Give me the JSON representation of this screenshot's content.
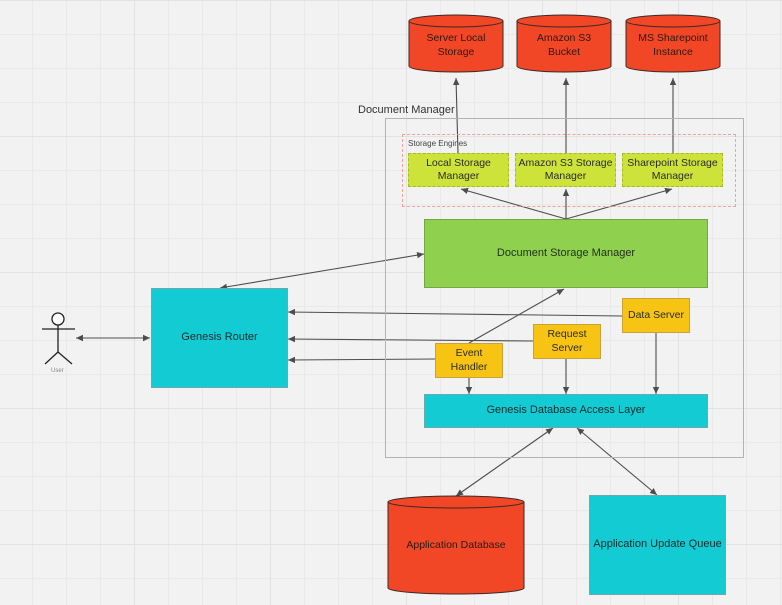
{
  "diagram": {
    "colors": {
      "storage_red": "#f24726",
      "engine_green": "#cde33a",
      "doc_manager_green": "#8fd14f",
      "cyan": "#13ccd3",
      "yellow": "#f8c413",
      "frame_gray": "#b3b3b3",
      "engines_dashed": "#f2a29a",
      "arrow": "#4d4d4d"
    },
    "external_storage": [
      {
        "id": "server-local-storage",
        "label": "Server Local Storage",
        "line1": "Server Local",
        "line2": "Storage"
      },
      {
        "id": "amazon-s3-bucket",
        "label": "Amazon S3 Bucket",
        "line1": "Amazon S3",
        "line2": "Bucket"
      },
      {
        "id": "ms-sharepoint-instance",
        "label": "MS Sharepoint Instance",
        "line1": "MS Sharepoint",
        "line2": "Instance"
      }
    ],
    "document_manager": {
      "title": "Document Manager",
      "storage_engines": {
        "title": "Storage Engines",
        "items": [
          {
            "id": "local-storage-manager",
            "line1": "Local Storage",
            "line2": "Manager"
          },
          {
            "id": "amazon-s3-storage-manager",
            "line1": "Amazon S3 Storage",
            "line2": "Manager"
          },
          {
            "id": "sharepoint-storage-manager",
            "line1": "Sharepoint Storage",
            "line2": "Manager"
          }
        ]
      },
      "document_storage_manager": "Document Storage Manager",
      "data_server": "Data Server",
      "request_server": {
        "line1": "Request",
        "line2": "Server"
      },
      "event_handler": {
        "line1": "Event",
        "line2": "Handler"
      },
      "database_access_layer": "Genesis Database Access Layer"
    },
    "genesis_router": "Genesis Router",
    "user": {
      "label": "User"
    },
    "application_database": "Application Database",
    "application_update_queue": "Application Update Queue",
    "connections": [
      {
        "from": "local-storage-manager",
        "to": "server-local-storage",
        "type": "one-way"
      },
      {
        "from": "amazon-s3-storage-manager",
        "to": "amazon-s3-bucket",
        "type": "one-way"
      },
      {
        "from": "sharepoint-storage-manager",
        "to": "ms-sharepoint-instance",
        "type": "one-way"
      },
      {
        "from": "document-storage-manager",
        "to": "local-storage-manager",
        "type": "one-way"
      },
      {
        "from": "document-storage-manager",
        "to": "amazon-s3-storage-manager",
        "type": "one-way"
      },
      {
        "from": "document-storage-manager",
        "to": "sharepoint-storage-manager",
        "type": "one-way"
      },
      {
        "from": "genesis-router",
        "to": "document-storage-manager",
        "type": "two-way"
      },
      {
        "from": "user",
        "to": "genesis-router",
        "type": "two-way"
      },
      {
        "from": "data-server",
        "to": "genesis-router",
        "type": "one-way"
      },
      {
        "from": "request-server",
        "to": "genesis-router",
        "type": "one-way"
      },
      {
        "from": "event-handler",
        "to": "genesis-router",
        "type": "one-way"
      },
      {
        "from": "event-handler",
        "to": "document-storage-manager",
        "type": "one-way"
      },
      {
        "from": "event-handler",
        "to": "genesis-database-access-layer",
        "type": "one-way"
      },
      {
        "from": "request-server",
        "to": "genesis-database-access-layer",
        "type": "one-way"
      },
      {
        "from": "data-server",
        "to": "genesis-database-access-layer",
        "type": "one-way"
      },
      {
        "from": "genesis-database-access-layer",
        "to": "application-database",
        "type": "two-way"
      },
      {
        "from": "genesis-database-access-layer",
        "to": "application-update-queue",
        "type": "two-way"
      }
    ]
  }
}
